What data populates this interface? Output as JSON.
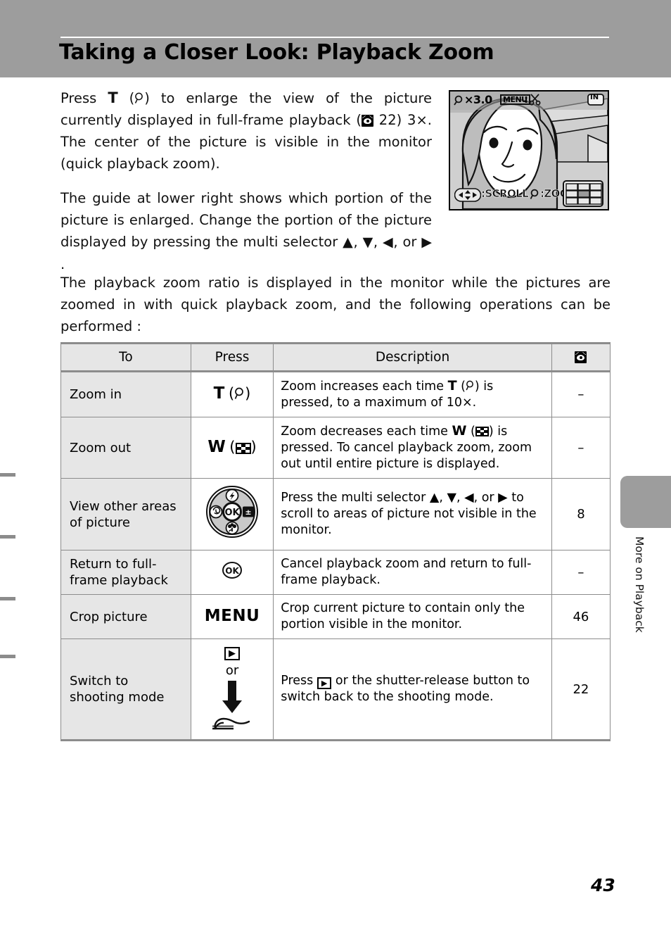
{
  "page": {
    "title": "Taking a Closer Look: Playback Zoom",
    "number": "43",
    "side_tab_label": "More on Playback",
    "header_bg": "#9d9d9d",
    "row_label_bg": "#e6e6e6"
  },
  "paragraphs": {
    "p1_a": "Press ",
    "p1_T": "T",
    "p1_b": " (",
    "p1_c": ") to enlarge the view of the picture currently displayed in full-frame playback (",
    "p1_ref": "22",
    "p1_d": ") 3×. The center of the picture is visible in the monitor (quick playback zoom).",
    "p2_a": "The guide at lower right shows which portion of the picture is enlarged. Change the portion of the picture displayed by pressing the multi selector ",
    "p2_up": "▲",
    "p2_down": "▼",
    "p2_left": "◀",
    "p2_or": ", or ",
    "p2_right": "▶",
    "p2_end": " .",
    "p3": "The playback zoom ratio is displayed in the monitor while the pictures are zoomed in with quick playback zoom, and the following operations can be performed :"
  },
  "monitor": {
    "zoom_ratio": "×3.0",
    "menu_label": "MENU",
    "menu_sep": ":",
    "in_badge": "IN",
    "scroll_label": ":SCROLL",
    "zoom_label": ":ZOOM",
    "guide_grid": {
      "rows": 3,
      "cols": 3,
      "highlight_row": 1,
      "highlight_col": 1
    }
  },
  "table": {
    "headers": {
      "to": "To",
      "press": "Press",
      "description": "Description",
      "page_ref_icon": "reference-page-icon"
    },
    "rows": [
      {
        "to": "Zoom in",
        "press_text": "T",
        "press_icon": "magnifier-icon",
        "desc_a": "Zoom increases each time ",
        "desc_T": "T",
        "desc_b": " (",
        "desc_c": ") is pressed, to a maximum of 10×.",
        "page": "–"
      },
      {
        "to": "Zoom out",
        "press_text": "W",
        "press_icon": "thumbnail-checker-icon",
        "desc_a": "Zoom decreases each time ",
        "desc_W": "W",
        "desc_b": " (",
        "desc_c": ") is pressed. To cancel playback zoom, zoom out until entire picture is displayed.",
        "page": "–"
      },
      {
        "to": "View other areas of picture",
        "press_icon": "multi-selector-icon",
        "desc_a": "Press the multi selector ",
        "desc_up": "▲",
        "desc_down": "▼",
        "desc_left": "◀",
        "desc_or": ", or ",
        "desc_right": "▶",
        "desc_b": " to scroll to areas of picture not visible in the monitor.",
        "page": "8"
      },
      {
        "to": "Return to full-frame playback",
        "press_icon": "ok-button-icon",
        "press_text": "OK",
        "desc_a": "Cancel playback zoom and return to full-frame playback.",
        "page": "–"
      },
      {
        "to": "Crop picture",
        "press_text": "MENU",
        "desc_a": "Crop current picture to contain only the portion visible in the monitor.",
        "page": "46"
      },
      {
        "to": "Switch to shooting mode",
        "press_icon": "playback-button-icon",
        "press_or": "or",
        "press_icon2": "shutter-release-finger-icon",
        "desc_a": "Press ",
        "desc_b": " or the shutter-release button to switch back to the shooting mode.",
        "page": "22"
      }
    ]
  }
}
